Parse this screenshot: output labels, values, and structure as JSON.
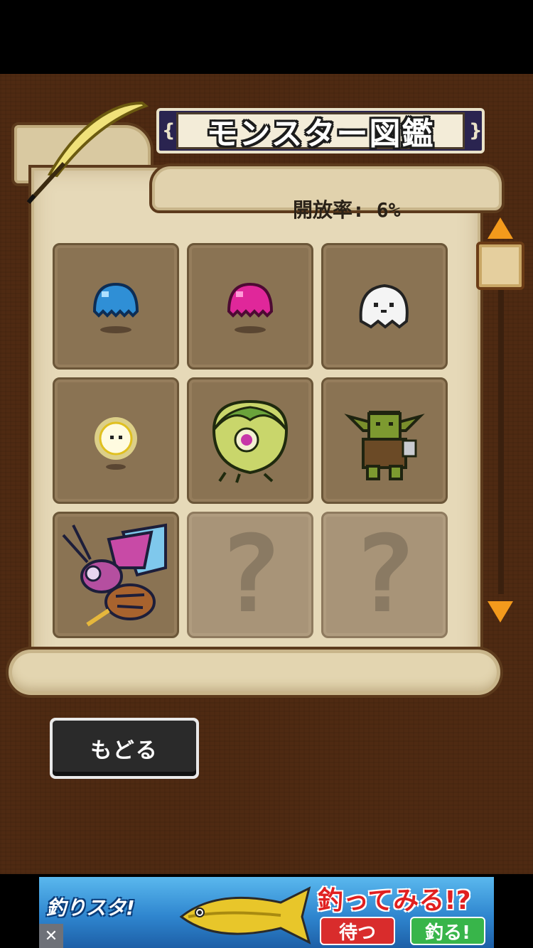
{
  "screen": {
    "title": "モンスター図鑑",
    "title_cap_left": "{",
    "title_cap_right": "}",
    "rate_label": "開放率: 6%"
  },
  "monsters": [
    {
      "name": "blue-slime",
      "unlocked": true
    },
    {
      "name": "pink-slime",
      "unlocked": true
    },
    {
      "name": "white-ghost",
      "unlocked": true
    },
    {
      "name": "glowing-wisp",
      "unlocked": true
    },
    {
      "name": "cabbage-eye-monster",
      "unlocked": true
    },
    {
      "name": "green-goblin",
      "unlocked": true
    },
    {
      "name": "giant-wasp",
      "unlocked": true
    },
    {
      "name": "unknown",
      "unlocked": false,
      "label": "?"
    },
    {
      "name": "unknown",
      "unlocked": false,
      "label": "?"
    }
  ],
  "buttons": {
    "back_label": "もどる"
  },
  "ad": {
    "logo": "釣りスタ!",
    "headline": "釣ってみる!?",
    "wait_label": "待つ",
    "fish_label": "釣る!",
    "close_label": "✕"
  },
  "colors": {
    "scroll_arrow": "#f39a1c",
    "background": "#4f2a12",
    "parchment": "#e6d9b8"
  }
}
